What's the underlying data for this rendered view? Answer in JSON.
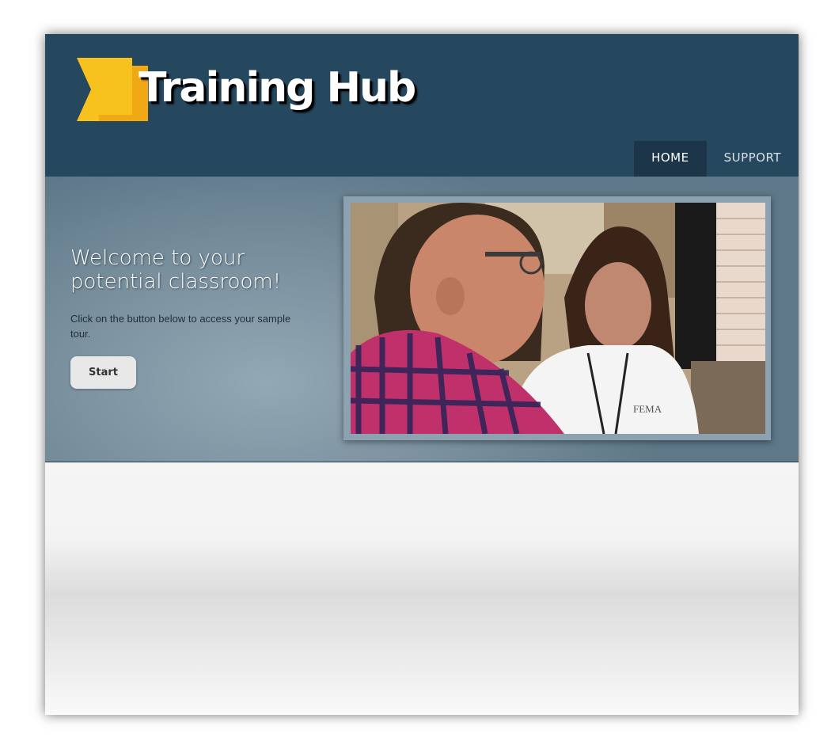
{
  "brand": {
    "name": "Training Hub"
  },
  "nav": {
    "items": [
      {
        "label": "HOME"
      },
      {
        "label": "SUPPORT"
      }
    ]
  },
  "hero": {
    "title": "Welcome to your potential classroom!",
    "subtitle": "Click on the button below  to access your sample tour.",
    "start_label": "Start",
    "image_text": "FEMA"
  },
  "colors": {
    "header_bg": "#26485f",
    "nav_active_bg": "#1c3548",
    "logo_yellow": "#f7c21d",
    "hero_bg": "#7d93a1"
  }
}
